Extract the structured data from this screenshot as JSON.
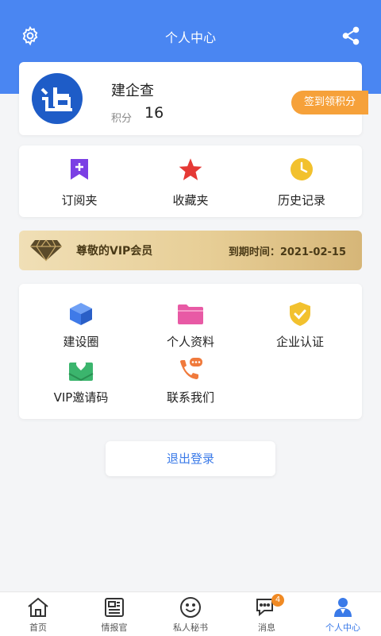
{
  "header": {
    "title": "个人中心",
    "settings_icon": "gear-icon",
    "share_icon": "share-icon",
    "bg_color": "#4a86f2"
  },
  "profile": {
    "name": "建企查",
    "points_label": "积分",
    "points_value": "16",
    "checkin_label": "签到领积分",
    "avatar_icon": "company-logo"
  },
  "quick_actions": [
    {
      "label": "订阅夹",
      "icon": "bookmark-plus-icon",
      "color": "#7b3fe4"
    },
    {
      "label": "收藏夹",
      "icon": "star-icon",
      "color": "#e53935"
    },
    {
      "label": "历史记录",
      "icon": "clock-icon",
      "color": "#f2c12e"
    }
  ],
  "vip": {
    "title": "尊敬的VIP会员",
    "expire": "到期时间：2021-02-15",
    "icon": "diamond-icon"
  },
  "menu": [
    {
      "label": "建设圈",
      "icon": "cube-icon",
      "color": "#3f7ae8"
    },
    {
      "label": "个人资料",
      "icon": "folder-icon",
      "color": "#e85aa5"
    },
    {
      "label": "企业认证",
      "icon": "shield-check-icon",
      "color": "#f2c12e"
    },
    {
      "label": "VIP邀请码",
      "icon": "mail-heart-icon",
      "color": "#3bb56d"
    },
    {
      "label": "联系我们",
      "icon": "phone-chat-icon",
      "color": "#f07a3c"
    }
  ],
  "logout_label": "退出登录",
  "tabbar": [
    {
      "label": "首页",
      "icon": "home-icon"
    },
    {
      "label": "情报官",
      "icon": "newspaper-icon"
    },
    {
      "label": "私人秘书",
      "icon": "smile-icon"
    },
    {
      "label": "消息",
      "icon": "message-icon",
      "badge": "4"
    },
    {
      "label": "个人中心",
      "icon": "user-icon",
      "active": true
    }
  ]
}
